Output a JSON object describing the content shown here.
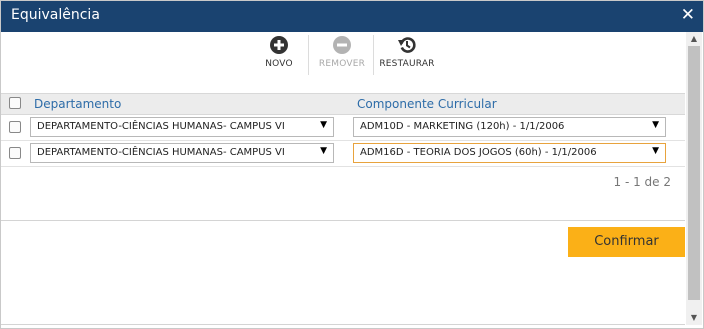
{
  "dialog": {
    "title": "Equivalência"
  },
  "toolbar": {
    "new_label": "NOVO",
    "remove_label": "REMOVER",
    "restore_label": "RESTAURAR"
  },
  "grid": {
    "columns": [
      "Departamento",
      "Componente Curricular"
    ],
    "rows": [
      {
        "departamento": "DEPARTAMENTO-CIÊNCIAS HUMANAS- CAMPUS VI",
        "componente": "ADM10D - MARKETING (120h) - 1/1/2006",
        "checked": false
      },
      {
        "departamento": "DEPARTAMENTO-CIÊNCIAS HUMANAS- CAMPUS VI",
        "componente": "ADM16D - TEORIA DOS JOGOS (60h) - 1/1/2006",
        "checked": false
      }
    ]
  },
  "pager": {
    "text": "1 - 1 de 2"
  },
  "actions": {
    "confirm_label": "Confirmar"
  },
  "colors": {
    "titlebar": "#1a4370",
    "accent": "#fbb017",
    "header_text": "#2d6ca8",
    "focus_border": "#e8a33d"
  },
  "icons": {
    "new": "plus-circle-icon",
    "remove": "minus-circle-icon",
    "restore": "restore-icon",
    "close": "close-icon"
  }
}
